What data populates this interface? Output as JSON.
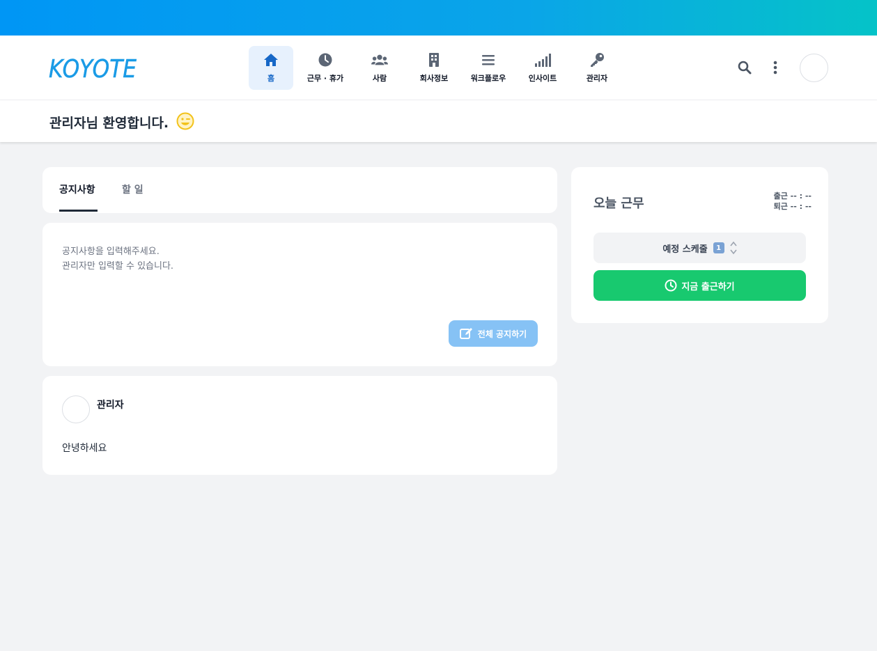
{
  "brand": {
    "logo_text": "KOYOTE",
    "accent": "#0096f5"
  },
  "nav": {
    "items": [
      {
        "label": "홈",
        "icon": "home-icon",
        "active": true
      },
      {
        "label": "근무 · 휴가",
        "icon": "clock-icon",
        "active": false
      },
      {
        "label": "사람",
        "icon": "users-icon",
        "active": false
      },
      {
        "label": "회사정보",
        "icon": "building-icon",
        "active": false
      },
      {
        "label": "워크플로우",
        "icon": "list-icon",
        "active": false
      },
      {
        "label": "인사이트",
        "icon": "signal-icon",
        "active": false
      },
      {
        "label": "관리자",
        "icon": "key-icon",
        "active": false
      }
    ]
  },
  "header": {
    "search_icon": "search-icon",
    "more_icon": "more-vertical-icon"
  },
  "welcome": {
    "text": "관리자님 환영합니다.",
    "emoji": "wink-emoji"
  },
  "tabs": [
    {
      "label": "공지사항",
      "active": true
    },
    {
      "label": "할 일",
      "active": false
    }
  ],
  "notice": {
    "line1": "공지사항을 입력해주세요.",
    "line2": "관리자만 입력할 수 있습니다.",
    "button_label": "전체 공지하기"
  },
  "post": {
    "author": "관리자",
    "body": "안녕하세요"
  },
  "work": {
    "title": "오늘 근무",
    "clock_in": "출근 -- : --",
    "clock_out": "퇴근 -- : --",
    "schedule_label": "예정 스케줄",
    "schedule_count": "1",
    "checkin_label": "지금 출근하기",
    "checkin_color": "#18c96f"
  }
}
